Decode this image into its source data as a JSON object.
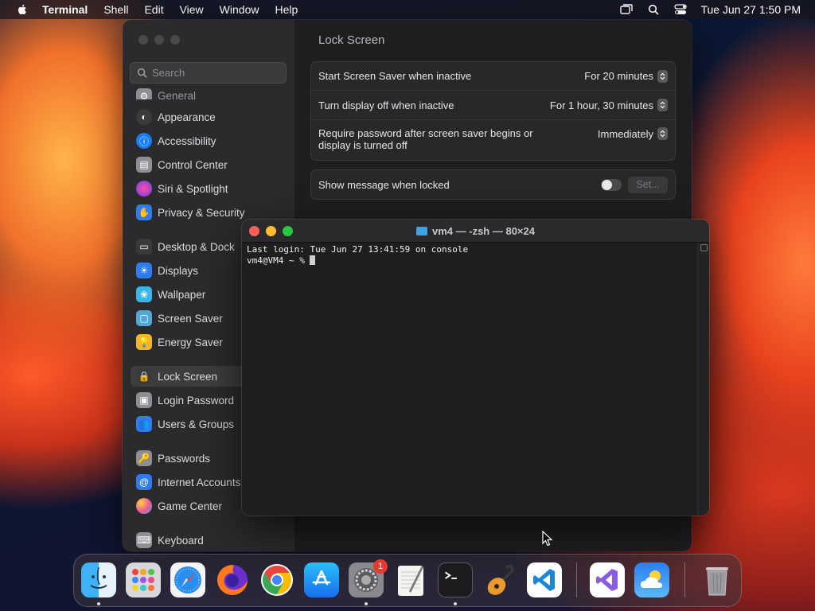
{
  "menubar": {
    "app_name": "Terminal",
    "menus": [
      "Shell",
      "Edit",
      "View",
      "Window",
      "Help"
    ],
    "clock": "Tue Jun 27  1:50 PM"
  },
  "settings": {
    "search_placeholder": "Search",
    "page_title": "Lock Screen",
    "sidebar": [
      {
        "label": "General",
        "icon": "gear-icon",
        "color": "#8e8e93"
      },
      {
        "label": "Appearance",
        "icon": "appearance-icon",
        "color": "#3a3a3c"
      },
      {
        "label": "Accessibility",
        "icon": "accessibility-icon",
        "color": "#1a7cf5"
      },
      {
        "label": "Control Center",
        "icon": "control-center-icon",
        "color": "#8e8e93"
      },
      {
        "label": "Siri & Spotlight",
        "icon": "siri-icon",
        "color": "#c13cd8"
      },
      {
        "label": "Privacy & Security",
        "icon": "hand-icon",
        "color": "#2f7bf0"
      },
      {
        "label": "Desktop & Dock",
        "icon": "desktop-icon",
        "color": "#3a3a3c"
      },
      {
        "label": "Displays",
        "icon": "displays-icon",
        "color": "#2f7bf0"
      },
      {
        "label": "Wallpaper",
        "icon": "wallpaper-icon",
        "color": "#38b6e8"
      },
      {
        "label": "Screen Saver",
        "icon": "screen-saver-icon",
        "color": "#4fa8d8"
      },
      {
        "label": "Energy Saver",
        "icon": "energy-icon",
        "color": "#f4b52c"
      },
      {
        "label": "Lock Screen",
        "icon": "lock-icon",
        "color": "#3a3a3c"
      },
      {
        "label": "Login Password",
        "icon": "login-password-icon",
        "color": "#8e8e93"
      },
      {
        "label": "Users & Groups",
        "icon": "users-icon",
        "color": "#2f7bf0"
      },
      {
        "label": "Passwords",
        "icon": "key-icon",
        "color": "#8e8e93"
      },
      {
        "label": "Internet Accounts",
        "icon": "at-icon",
        "color": "#2f7bf0"
      },
      {
        "label": "Game Center",
        "icon": "game-center-icon",
        "color": "#e85a9a"
      },
      {
        "label": "Keyboard",
        "icon": "keyboard-icon",
        "color": "#8e8e93"
      }
    ],
    "rows": [
      {
        "label": "Start Screen Saver when inactive",
        "value": "For 20 minutes"
      },
      {
        "label": "Turn display off when inactive",
        "value": "For 1 hour, 30 minutes"
      },
      {
        "label": "Require password after screen saver begins or",
        "label2": "display is turned off",
        "value": "Immediately"
      }
    ],
    "message_row": {
      "label": "Show message when locked",
      "toggle_on": false,
      "button": "Set..."
    }
  },
  "terminal": {
    "title": "vm4 — -zsh — 80×24",
    "line1": "Last login: Tue Jun 27 13:41:59 on console",
    "prompt": "vm4@VM4 ~ % "
  },
  "dock": {
    "apps": [
      "Finder",
      "Launchpad",
      "Safari",
      "Firefox",
      "Google Chrome",
      "App Store",
      "System Settings",
      "TextEdit",
      "Terminal",
      "GarageBand",
      "Visual Studio Code",
      "Visual Studio",
      "Weather",
      "Trash"
    ],
    "settings_badge": "1"
  }
}
